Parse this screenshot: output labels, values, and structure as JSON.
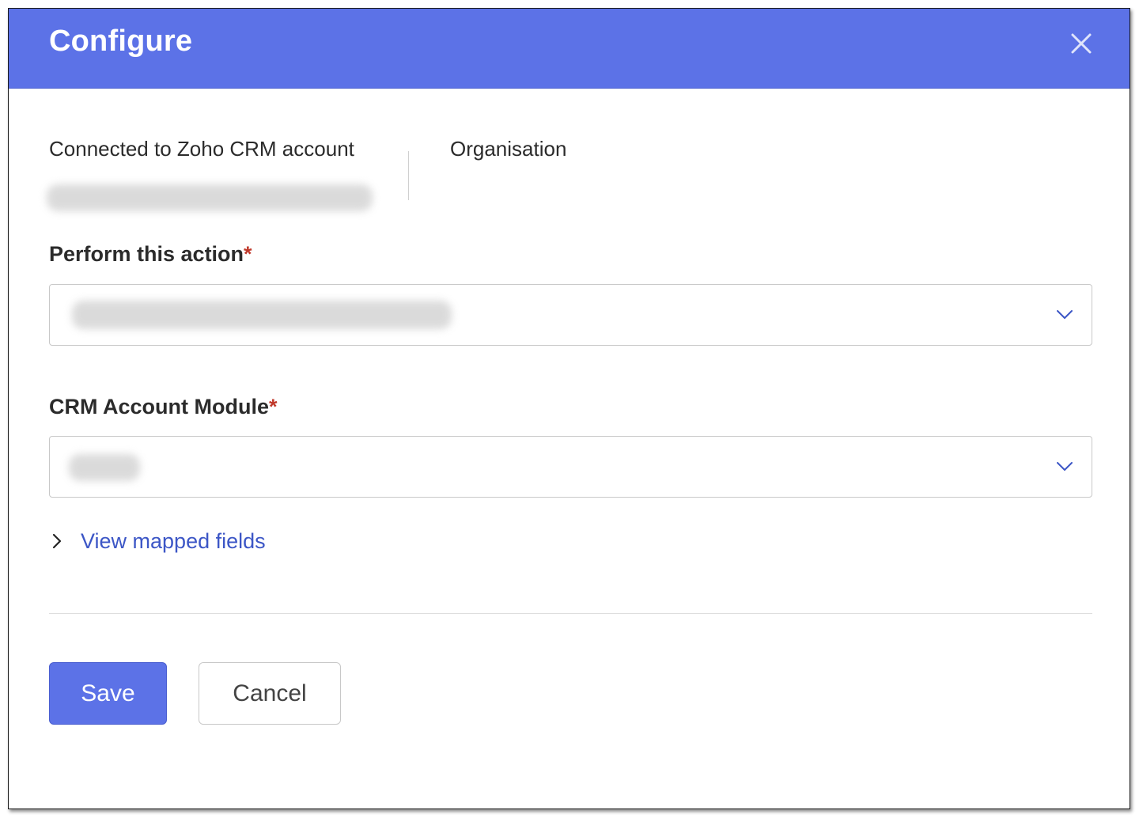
{
  "dialog": {
    "title": "Configure",
    "close_icon": "close-icon"
  },
  "connection": {
    "label": "Connected to Zoho CRM account",
    "organisation_label": "Organisation"
  },
  "action_field": {
    "label": "Perform this action",
    "required_marker": "*",
    "chevron_icon": "chevron-down-icon"
  },
  "module_field": {
    "label": "CRM Account Module",
    "required_marker": "*",
    "chevron_icon": "chevron-down-icon"
  },
  "mapped_fields": {
    "label": "View mapped fields",
    "icon": "chevron-right-icon"
  },
  "buttons": {
    "save_label": "Save",
    "cancel_label": "Cancel"
  },
  "colors": {
    "primary": "#5c72e7",
    "link": "#3c56c6",
    "required": "#c0392b"
  }
}
